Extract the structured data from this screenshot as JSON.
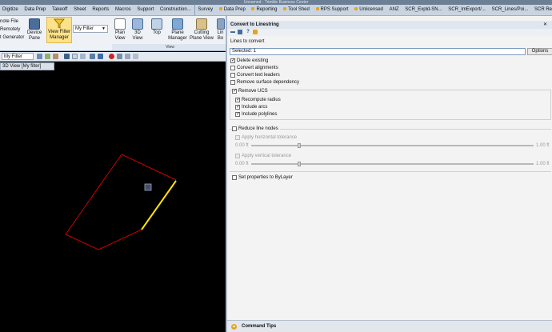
{
  "window": {
    "title": "Unnamed - Trimble Business Center"
  },
  "ribbon_tabs": [
    {
      "label": "Digitize"
    },
    {
      "label": "Data Prep"
    },
    {
      "label": "Takeoff"
    },
    {
      "label": "Sheet"
    },
    {
      "label": "Reports"
    },
    {
      "label": "Macros"
    },
    {
      "label": "Support"
    },
    {
      "label": "Construction..."
    },
    {
      "label": "Survey"
    },
    {
      "label": "Data Prep"
    },
    {
      "label": "Reporting"
    },
    {
      "label": "Tool Shed"
    },
    {
      "label": "RPS Support"
    },
    {
      "label": "Unlicensed"
    },
    {
      "label": "ANZ"
    },
    {
      "label": "SCR_Expld-SN..."
    },
    {
      "label": "SCR_ImExport/..."
    },
    {
      "label": "SCR_Lines/Poi..."
    },
    {
      "label": "SCR Reports"
    }
  ],
  "ribbon": {
    "left_items": [
      "note File",
      "Remotely",
      "t Generator"
    ],
    "device_pane": "Device\nPane",
    "view_filter_manager": "View Filter\nManager",
    "filter_select": "My Filter",
    "plan_view": "Plan\nView",
    "view_3d": "3D\nView",
    "top": "Top",
    "plane_manager": "Plane\nManager",
    "cutting_plane_view": "Cutting\nPlane View",
    "line_bo": "Lin\nBo",
    "group_label": "View"
  },
  "toolbar": {
    "filter": "My Filter"
  },
  "viewport": {
    "tab_label": "3D View [My filter]",
    "background": "#000000",
    "polygon_color": "#cc0000",
    "highlight_color": "#ffe600"
  },
  "panel": {
    "title": "Convert to Linestring",
    "pin": "✕",
    "lines_to_convert_label": "Lines to convert",
    "selected_value": "Selected: 1",
    "options_button": "Options",
    "delete_existing": "Delete existing",
    "convert_alignments": "Convert alignments",
    "convert_text_leaders": "Convert text leaders",
    "remove_surface_dependency": "Remove surface dependency",
    "remove_ucs": "Remove UCS",
    "recompute_radius": "Recompute radius",
    "include_arcs": "Include arcs",
    "include_polylines": "Include polylines",
    "reduce_line_nodes": "Reduce line nodes",
    "apply_horizontal_tolerance": "Apply horizontal tolerance",
    "apply_vertical_tolerance": "Apply vertical tolerance",
    "h_min": "0.00 ft",
    "h_max": "1.00 ft",
    "v_min": "0.00 ft",
    "v_max": "1.00 ft",
    "set_properties_bylayer": "Set properties to ByLayer",
    "command_tips": "Command Tips"
  },
  "checkbox_state": {
    "delete_existing": true,
    "convert_alignments": false,
    "convert_text_leaders": false,
    "remove_surface_dependency": false,
    "remove_ucs": true,
    "recompute_radius": true,
    "include_arcs": true,
    "include_polylines": true,
    "reduce_line_nodes": false,
    "apply_horizontal_tolerance": false,
    "apply_vertical_tolerance": false,
    "set_properties_bylayer": false
  }
}
